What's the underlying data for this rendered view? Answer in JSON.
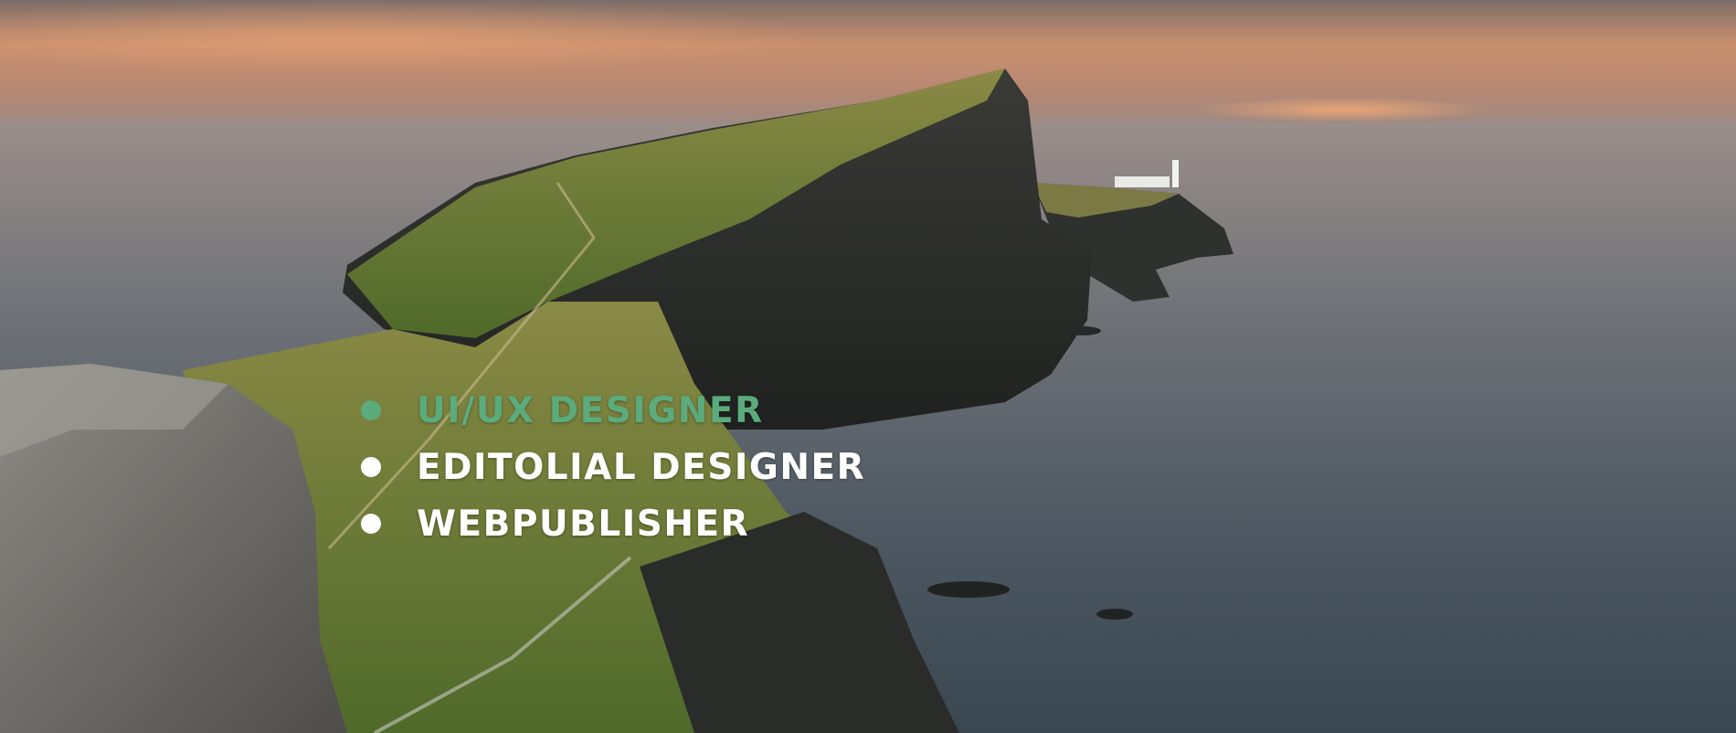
{
  "colors": {
    "accent": "#5bab7c",
    "text": "#ffffff",
    "sky_top": "#8a7c76",
    "sky_glow": "#e6a27a",
    "sea": "#4f5a63",
    "cliff": "#2f302c",
    "grass": "#6f8a3c"
  },
  "hero": {
    "image_description": "landscape-cliffs-lighthouse"
  },
  "roles": [
    {
      "label": "UI/UX DESIGNER",
      "active": true
    },
    {
      "label": "EDITOLIAL DESIGNER",
      "active": false
    },
    {
      "label": "WEBPUBLISHER",
      "active": false
    }
  ]
}
